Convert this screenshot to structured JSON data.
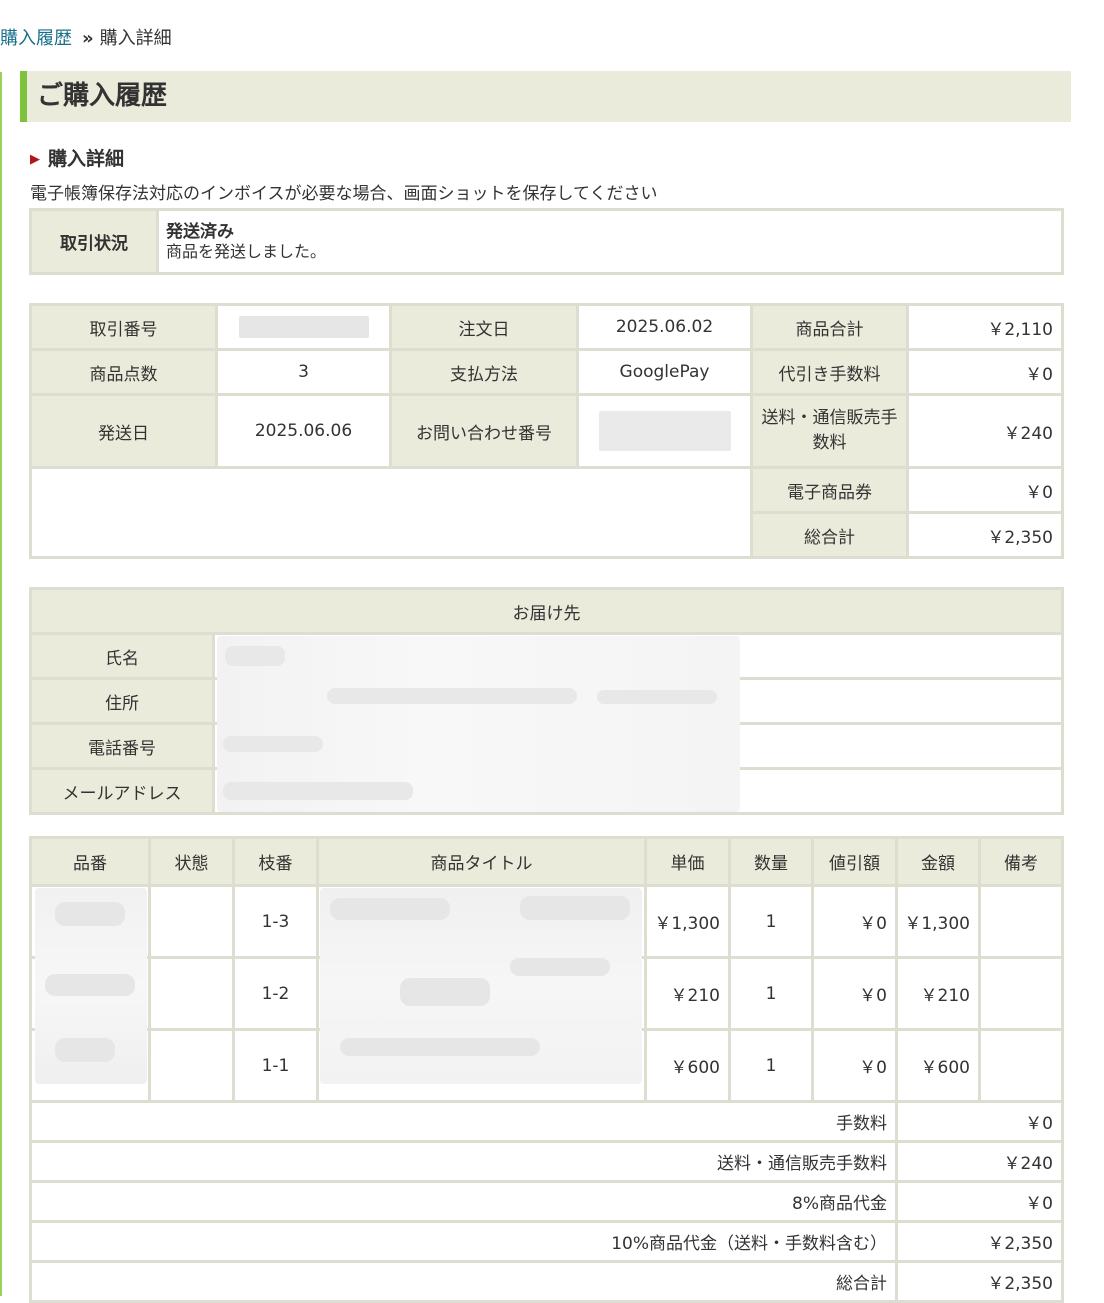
{
  "breadcrumb": {
    "link": "購入履歴",
    "separator": "»",
    "current": "購入詳細"
  },
  "page_title": "ご購入履歴",
  "section_title": "購入詳細",
  "note": "電子帳簿保存法対応のインボイスが必要な場合、画面ショットを保存してください",
  "status": {
    "label": "取引状況",
    "value": "発送済み",
    "message": "商品を発送しました。"
  },
  "order": {
    "transaction_no_label": "取引番号",
    "order_date_label": "注文日",
    "order_date": "2025.06.02",
    "subtotal_label": "商品合計",
    "subtotal": "￥2,110",
    "item_count_label": "商品点数",
    "item_count": "3",
    "payment_label": "支払方法",
    "payment": "GooglePay",
    "cod_fee_label": "代引き手数料",
    "cod_fee": "￥0",
    "ship_date_label": "発送日",
    "ship_date": "2025.06.06",
    "inquiry_no_label": "お問い合わせ番号",
    "shipping_fee_label": "送料・通信販売手数料",
    "shipping_fee": "￥240",
    "voucher_label": "電子商品券",
    "voucher": "￥0",
    "total_label": "総合計",
    "total": "￥2,350"
  },
  "destination": {
    "header": "お届け先",
    "name_label": "氏名",
    "address_label": "住所",
    "phone_label": "電話番号",
    "email_label": "メールアドレス"
  },
  "items": {
    "headers": {
      "sku": "品番",
      "condition": "状態",
      "branch": "枝番",
      "title": "商品タイトル",
      "unit_price": "単価",
      "qty": "数量",
      "discount": "値引額",
      "amount": "金額",
      "remarks": "備考"
    },
    "rows": [
      {
        "branch": "1-3",
        "unit_price": "￥1,300",
        "qty": "1",
        "discount": "￥0",
        "amount": "￥1,300"
      },
      {
        "branch": "1-2",
        "unit_price": "￥210",
        "qty": "1",
        "discount": "￥0",
        "amount": "￥210"
      },
      {
        "branch": "1-1",
        "unit_price": "￥600",
        "qty": "1",
        "discount": "￥0",
        "amount": "￥600"
      }
    ],
    "summary": [
      {
        "label": "手数料",
        "value": "￥0"
      },
      {
        "label": "送料・通信販売手数料",
        "value": "￥240"
      },
      {
        "label": "8%商品代金",
        "value": "￥0"
      },
      {
        "label": "10%商品代金（送料・手数料含む）",
        "value": "￥2,350"
      },
      {
        "label": "総合計",
        "value": "￥2,350"
      }
    ]
  }
}
